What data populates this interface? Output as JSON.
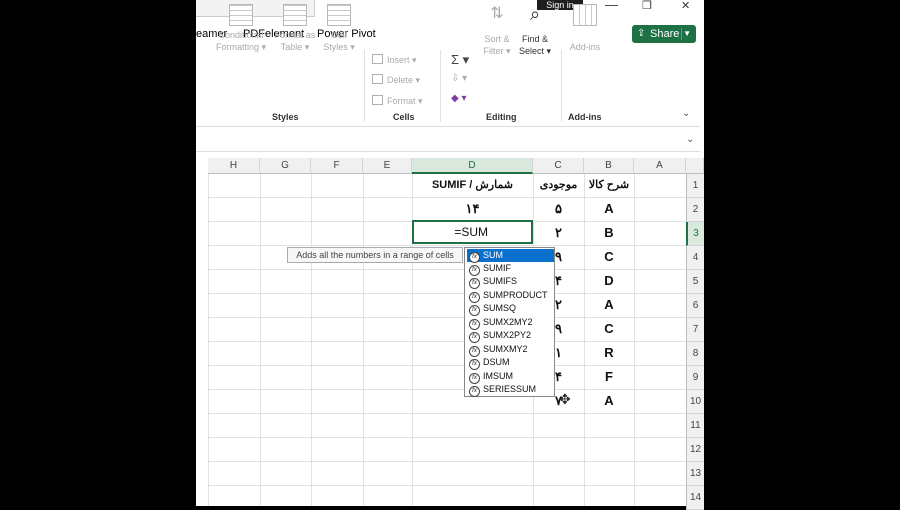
{
  "titlebar": {
    "sign_in": "Sign in",
    "minimize": "—",
    "restore": "❐",
    "close": "✕"
  },
  "menu": {
    "items": [
      "eamer",
      "PDFelement",
      "Power Pivot"
    ],
    "share_label": "Share"
  },
  "ribbon": {
    "styles": {
      "label": "Styles",
      "conditional": [
        "Conditional",
        "Formatting ▾"
      ],
      "format_table": [
        "Format as",
        "Table ▾"
      ],
      "cell_styles": [
        "Cell",
        "Styles ▾"
      ]
    },
    "cells": {
      "label": "Cells",
      "insert": "Insert ▾",
      "delete": "Delete ▾",
      "format": "Format ▾"
    },
    "editing": {
      "label": "Editing",
      "sum_icon": "Σ ▾",
      "fill_icon": "⇩ ▾",
      "clear_icon": "◆ ▾",
      "sort": [
        "Sort &",
        "Filter ▾"
      ],
      "find": [
        "Find &",
        "Select ▾"
      ]
    },
    "addins": {
      "label": "Add-ins",
      "addins": "Add-ins"
    }
  },
  "columns": [
    "H",
    "G",
    "F",
    "E",
    "D",
    "C",
    "B",
    "A"
  ],
  "rows": [
    "1",
    "2",
    "3",
    "4",
    "5",
    "6",
    "7",
    "8",
    "9",
    "10",
    "11",
    "12",
    "13",
    "14"
  ],
  "cells": {
    "d1": "SUMIF / شمارش",
    "c1": "موجودی",
    "b1": "شرح کالا",
    "d2": "۱۴",
    "c_col": [
      "۵",
      "۲",
      "۹",
      "۴",
      "۲",
      "۹",
      "۱",
      "۴",
      "۷"
    ],
    "b_col": [
      "A",
      "B",
      "C",
      "D",
      "A",
      "C",
      "R",
      "F",
      "A"
    ]
  },
  "active_cell_value": "=SUM",
  "tooltip": "Adds all the numbers in a range of cells",
  "autocomplete": [
    "SUM",
    "SUMIF",
    "SUMIFS",
    "SUMPRODUCT",
    "SUMSQ",
    "SUMX2MY2",
    "SUMX2PY2",
    "SUMXMY2",
    "DSUM",
    "IMSUM",
    "SERIESSUM"
  ],
  "selected_autocomplete": "SUM",
  "colors": {
    "excel_green": "#1e7145",
    "selection_blue": "#0b6fcc"
  }
}
